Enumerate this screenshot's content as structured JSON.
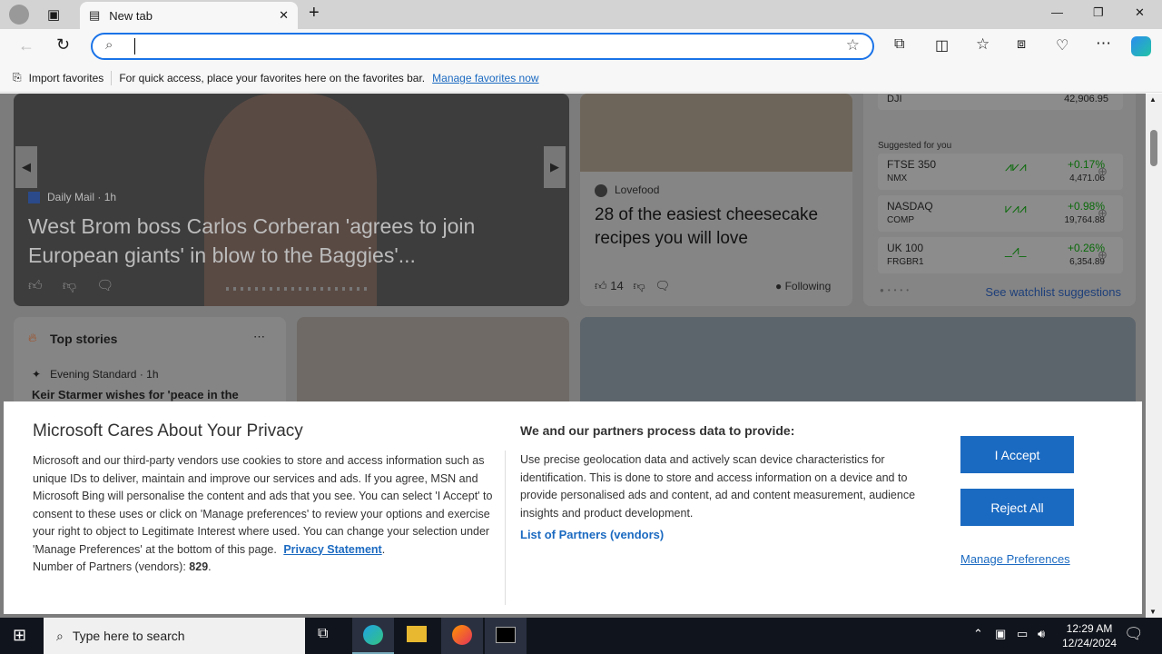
{
  "browser": {
    "tab_title": "New tab",
    "address_value": "",
    "favbar": {
      "import": "Import favorites",
      "hint": "For quick access, place your favorites here on the favorites bar.",
      "manage": "Manage favorites now"
    }
  },
  "hero": {
    "source": "Daily Mail",
    "time": "1h",
    "title": "West Brom boss Carlos Corberan 'agrees to join European giants' in blow to the Baggies'..."
  },
  "food": {
    "source": "Lovefood",
    "title": "28 of the easiest cheesecake recipes you will love",
    "likes": "14",
    "following": "Following"
  },
  "markets": {
    "top": {
      "symbol": "DJI",
      "value": "42,906.95"
    },
    "suggested_label": "Suggested for you",
    "items": [
      {
        "name": "FTSE 350",
        "symbol": "NMX",
        "change": "+0.17%",
        "value": "4,471.06"
      },
      {
        "name": "NASDAQ",
        "symbol": "COMP",
        "change": "+0.98%",
        "value": "19,764.88"
      },
      {
        "name": "UK 100",
        "symbol": "FRGBR1",
        "change": "+0.26%",
        "value": "6,354.89"
      }
    ],
    "link": "See watchlist suggestions",
    "up_color": "#0a7a0a"
  },
  "top_stories": {
    "title": "Top stories",
    "source": "Evening Standard",
    "time": "1h",
    "headline": "Keir Starmer wishes for 'peace in the"
  },
  "privacy": {
    "title": "Microsoft Cares About Your Privacy",
    "body": "Microsoft and our third-party vendors use cookies to store and access information such as unique IDs to deliver, maintain and improve our services and ads. If you agree, MSN and Microsoft Bing will personalise the content and ads that you see. You can select 'I Accept' to consent to these uses or click on 'Manage preferences' to review your options and exercise your right to object to Legitimate Interest where used.  You can change your selection under 'Manage Preferences' at the bottom of this page.",
    "privacy_link": "Privacy Statement",
    "partners_label": "Number of Partners (vendors):",
    "partners_count": "829",
    "right_title": "We and our partners process data to provide:",
    "right_body": "Use precise geolocation data and actively scan device characteristics for identification. This is done to store and access information on a device and to provide personalised ads and content, ad and content measurement, audience insights and product development.",
    "vendors_link": "List of Partners (vendors)",
    "accept": "I Accept",
    "reject": "Reject All",
    "manage": "Manage Preferences",
    "accent": "#1b6ac1"
  },
  "taskbar": {
    "search_placeholder": "Type here to search",
    "time": "12:29 AM",
    "date": "12/24/2024"
  }
}
